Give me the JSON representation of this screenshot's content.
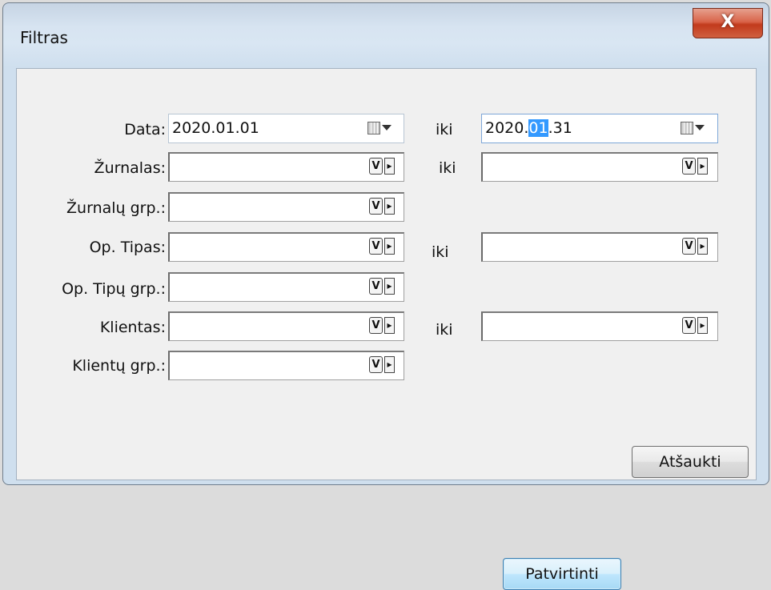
{
  "window": {
    "title": "Filtras",
    "close_symbol": "X"
  },
  "form": {
    "rows": [
      {
        "label": "Data:",
        "from_value": "2020.01.01",
        "iki": "iki",
        "to_value_prefix": "2020.",
        "to_value_selected": "01",
        "to_value_suffix": ".31"
      },
      {
        "label": "Žurnalas:",
        "from_value": "",
        "iki": "iki",
        "to_value": ""
      },
      {
        "label": "Žurnalų grp.:",
        "from_value": ""
      },
      {
        "label": "Op. Tipas:",
        "from_value": "",
        "iki": "iki",
        "to_value": ""
      },
      {
        "label": "Op. Tipų grp.:",
        "from_value": ""
      },
      {
        "label": "Klientas:",
        "from_value": "",
        "iki": "iki",
        "to_value": ""
      },
      {
        "label": "Klientų grp.:",
        "from_value": ""
      }
    ],
    "lookup_button_glyph": "V",
    "arrow_button_glyph": "▸"
  },
  "buttons": {
    "confirm": "Patvirtinti",
    "cancel": "Atšaukti"
  }
}
